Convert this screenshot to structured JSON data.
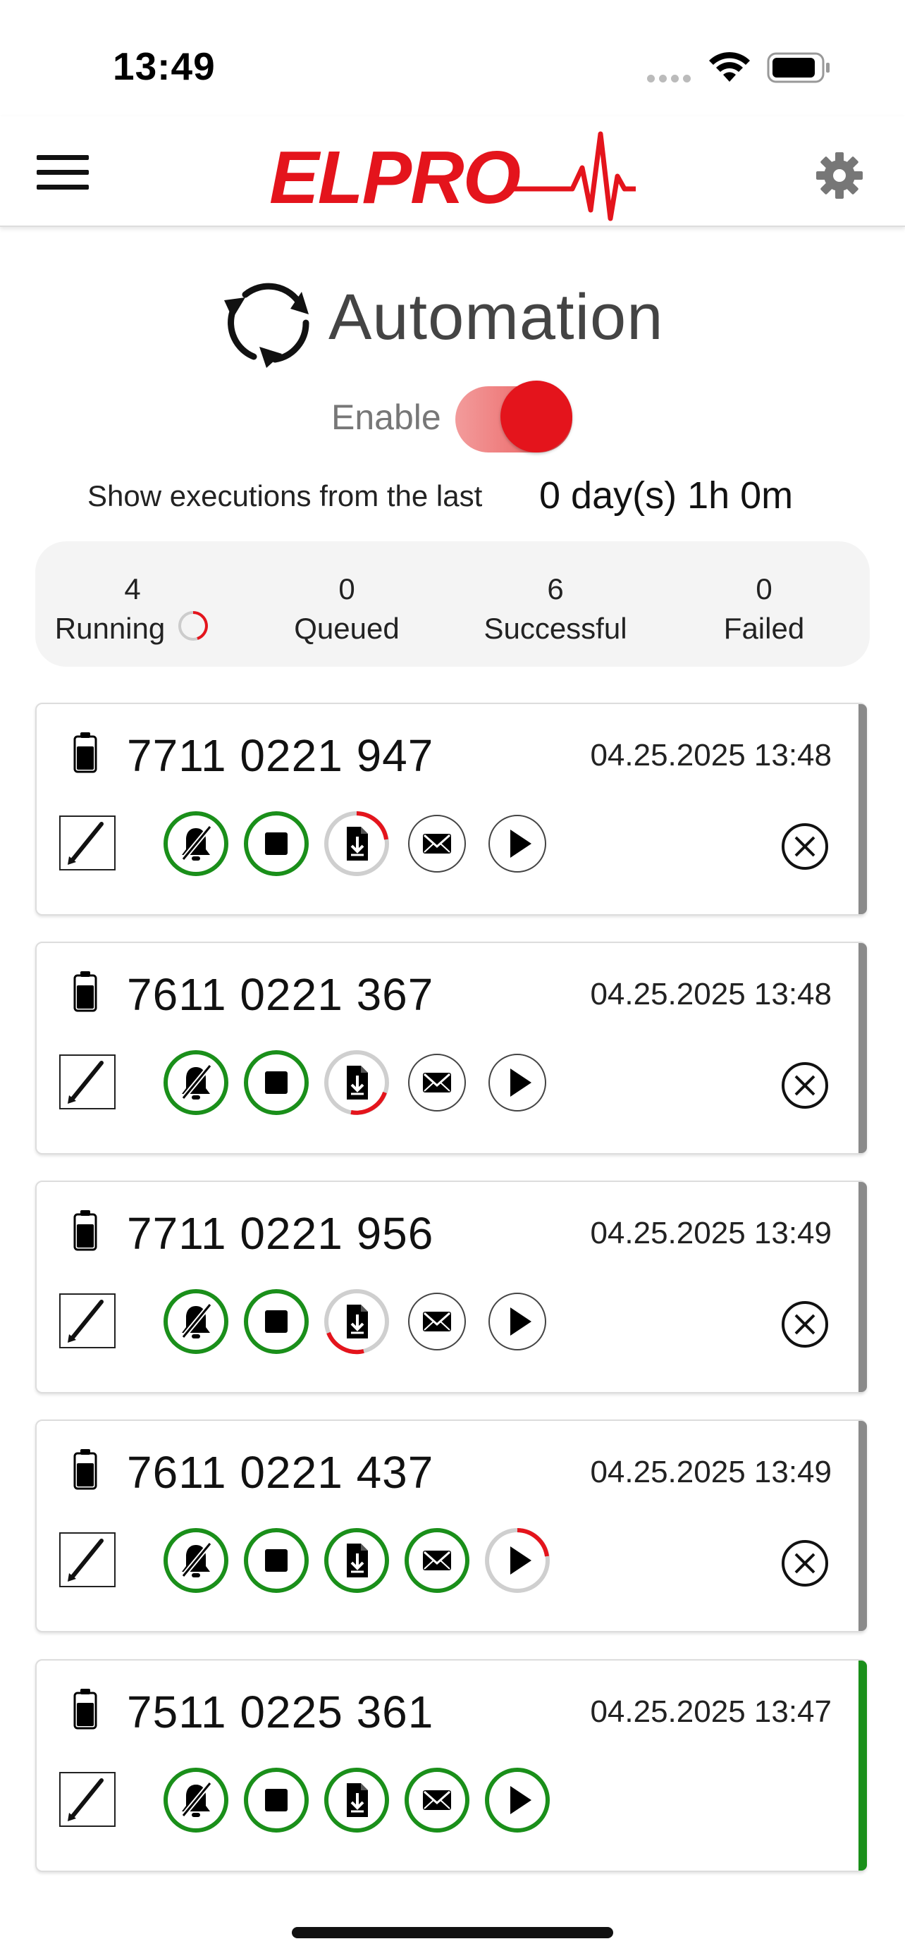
{
  "status_bar": {
    "time": "13:49"
  },
  "header": {
    "logo_text": "ELPRO"
  },
  "page": {
    "title": "Automation",
    "enable_label": "Enable",
    "enabled": true,
    "executions_label": "Show executions from the last",
    "executions_value": "0 day(s) 1h 0m"
  },
  "stats": {
    "running": {
      "count": "4",
      "label": "Running"
    },
    "queued": {
      "count": "0",
      "label": "Queued"
    },
    "successful": {
      "count": "6",
      "label": "Successful"
    },
    "failed": {
      "count": "0",
      "label": "Failed"
    }
  },
  "colors": {
    "accent_red": "#e4141c",
    "success_green": "#1a8f1a",
    "neutral_bar": "#8a8a8a"
  },
  "executions": [
    {
      "serial": "7711 0221 947",
      "datetime": "04.25.2025 13:48",
      "status": "running",
      "actions": [
        "done",
        "done",
        "progress-top",
        "pending",
        "pending"
      ],
      "cancellable": true
    },
    {
      "serial": "7611 0221 367",
      "datetime": "04.25.2025 13:48",
      "status": "running",
      "actions": [
        "done",
        "done",
        "progress-bottom",
        "pending",
        "pending"
      ],
      "cancellable": true
    },
    {
      "serial": "7711 0221 956",
      "datetime": "04.25.2025 13:49",
      "status": "running",
      "actions": [
        "done",
        "done",
        "progress-left",
        "pending",
        "pending"
      ],
      "cancellable": true
    },
    {
      "serial": "7611 0221 437",
      "datetime": "04.25.2025 13:49",
      "status": "running",
      "actions": [
        "done",
        "done",
        "done",
        "done",
        "progress-top"
      ],
      "cancellable": true
    },
    {
      "serial": "7511 0225 361",
      "datetime": "04.25.2025 13:47",
      "status": "successful",
      "actions": [
        "done",
        "done",
        "done",
        "done",
        "done"
      ],
      "cancellable": false
    }
  ],
  "action_icons": [
    "mute-alarm-icon",
    "stop-icon",
    "download-document-icon",
    "email-icon",
    "play-icon"
  ]
}
